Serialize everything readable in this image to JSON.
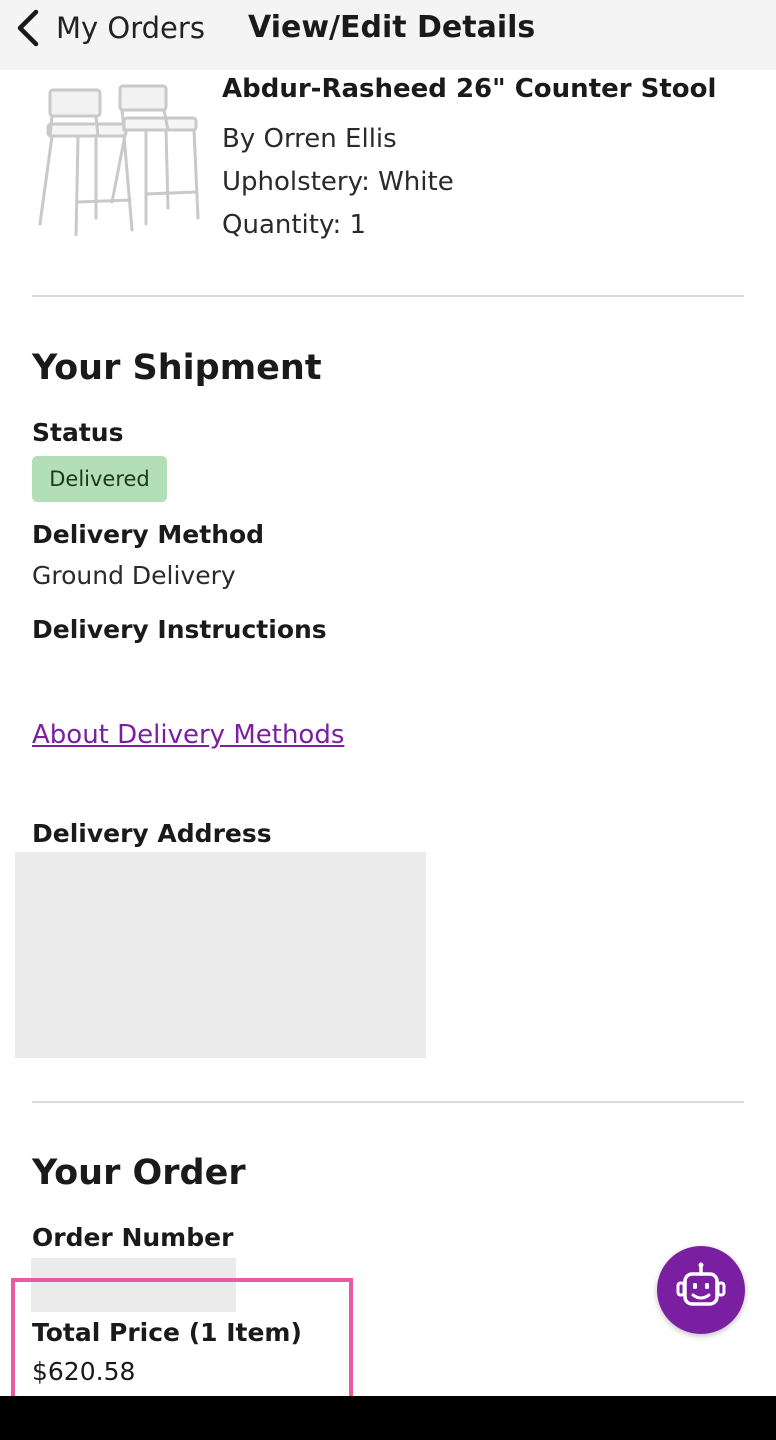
{
  "header": {
    "back_label": "My Orders",
    "title": "View/Edit Details"
  },
  "product": {
    "name": "Abdur-Rasheed 26\" Counter Stool",
    "brand": "By Orren Ellis",
    "upholstery": "Upholstery: White",
    "quantity": "Quantity: 1"
  },
  "shipment": {
    "title": "Your Shipment",
    "status_label": "Status",
    "status_value": "Delivered",
    "method_label": "Delivery Method",
    "method_value": "Ground Delivery",
    "instructions_label": "Delivery Instructions",
    "about_link": "About Delivery Methods",
    "address_label": "Delivery Address"
  },
  "order": {
    "title": "Your Order",
    "number_label": "Order Number",
    "total_label": "Total Price (1 Item)",
    "total_value": "$620.58"
  },
  "icons": {
    "back": "chevron-left-icon",
    "assistant": "robot-icon"
  },
  "colors": {
    "accent": "#7b1fa2",
    "status_green": "#b2dfb6",
    "highlight": "#e85aa3"
  }
}
